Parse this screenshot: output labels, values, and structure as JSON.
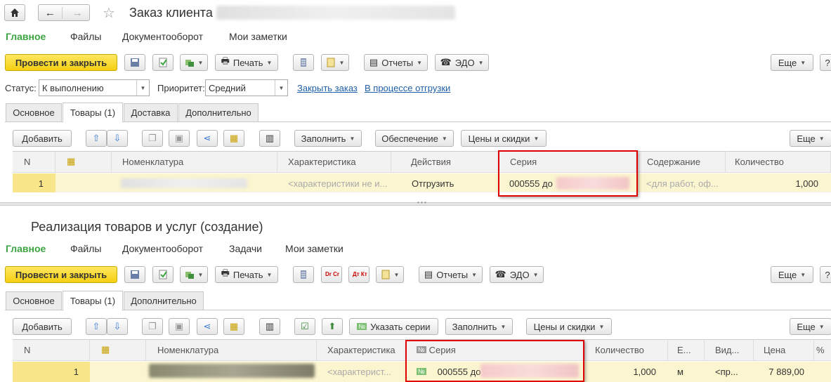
{
  "doc1": {
    "title": "Заказ клиента",
    "menu": [
      "Главное",
      "Файлы",
      "Документооборот",
      "Мои заметки"
    ],
    "toolbar": {
      "post_close": "Провести и закрыть",
      "print": "Печать",
      "reports": "Отчеты",
      "edo": "ЭДО",
      "more": "Еще"
    },
    "status_label": "Статус:",
    "status_value": "К выполнению",
    "priority_label": "Приоритет:",
    "priority_value": "Средний",
    "link_close": "Закрыть заказ",
    "link_shipping": "В процессе отгрузки",
    "tabs": [
      "Основное",
      "Товары (1)",
      "Доставка",
      "Дополнительно"
    ],
    "table_toolbar": {
      "add": "Добавить",
      "fill": "Заполнить",
      "supply": "Обеспечение",
      "prices": "Цены и скидки",
      "more": "Еще"
    },
    "columns": [
      "N",
      "Номенклатура",
      "Характеристика",
      "Действия",
      "Серия",
      "Содержание",
      "Количество"
    ],
    "row": {
      "n": "1",
      "characteristic": "<характеристики не и...",
      "action": "Отгрузить",
      "series": "000555 до",
      "content": "<для работ, оф...",
      "quantity": "1,000"
    }
  },
  "doc2": {
    "title": "Реализация товаров и услуг (создание)",
    "menu": [
      "Главное",
      "Файлы",
      "Документооборот",
      "Задачи",
      "Мои заметки"
    ],
    "toolbar": {
      "post_close": "Провести и закрыть",
      "print": "Печать",
      "reports": "Отчеты",
      "edo": "ЭДО",
      "more": "Еще",
      "dt_kt_1": "Dr Cr",
      "dt_kt_2": "Дт Кт"
    },
    "tabs": [
      "Основное",
      "Товары (1)",
      "Дополнительно"
    ],
    "table_toolbar": {
      "add": "Добавить",
      "set_series": "Указать серии",
      "fill": "Заполнить",
      "prices": "Цены и скидки",
      "more": "Еще"
    },
    "columns": [
      "N",
      "Номенклатура",
      "Характеристика",
      "Серия",
      "Количество",
      "Е...",
      "Вид...",
      "Цена",
      "%"
    ],
    "series_badge": "№",
    "row": {
      "n": "1",
      "characteristic": "<характерист...",
      "series": "000555 до",
      "quantity": "1,000",
      "unit": "м",
      "kind": "<пр...",
      "price": "7 889,00"
    }
  },
  "splitter": "• • •",
  "colors": {
    "accent_green": "#3ca541",
    "highlight_row": "#fbf5d0",
    "red_box": "#e00000",
    "link": "#1f5fa9"
  }
}
